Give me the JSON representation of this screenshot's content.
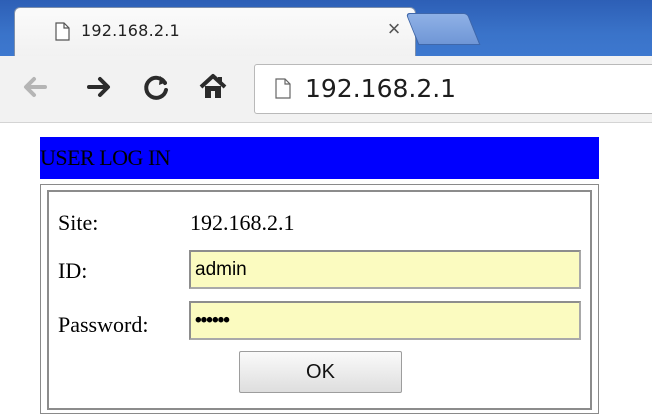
{
  "browser": {
    "tab": {
      "title": "192.168.2.1",
      "close_glyph": "×"
    },
    "address": {
      "url": "192.168.2.1"
    },
    "icons": [
      "back-icon",
      "forward-icon",
      "reload-icon",
      "home-icon",
      "page-icon"
    ]
  },
  "login": {
    "header": "USER LOG IN",
    "header_color": "#0000ff",
    "site_label": "Site:",
    "site_value": "192.168.2.1",
    "id_label": "ID:",
    "id_value": "admin",
    "password_label": "Password:",
    "password_value": "••••••",
    "field_color": "#fbfbc0",
    "ok_label": "OK"
  }
}
